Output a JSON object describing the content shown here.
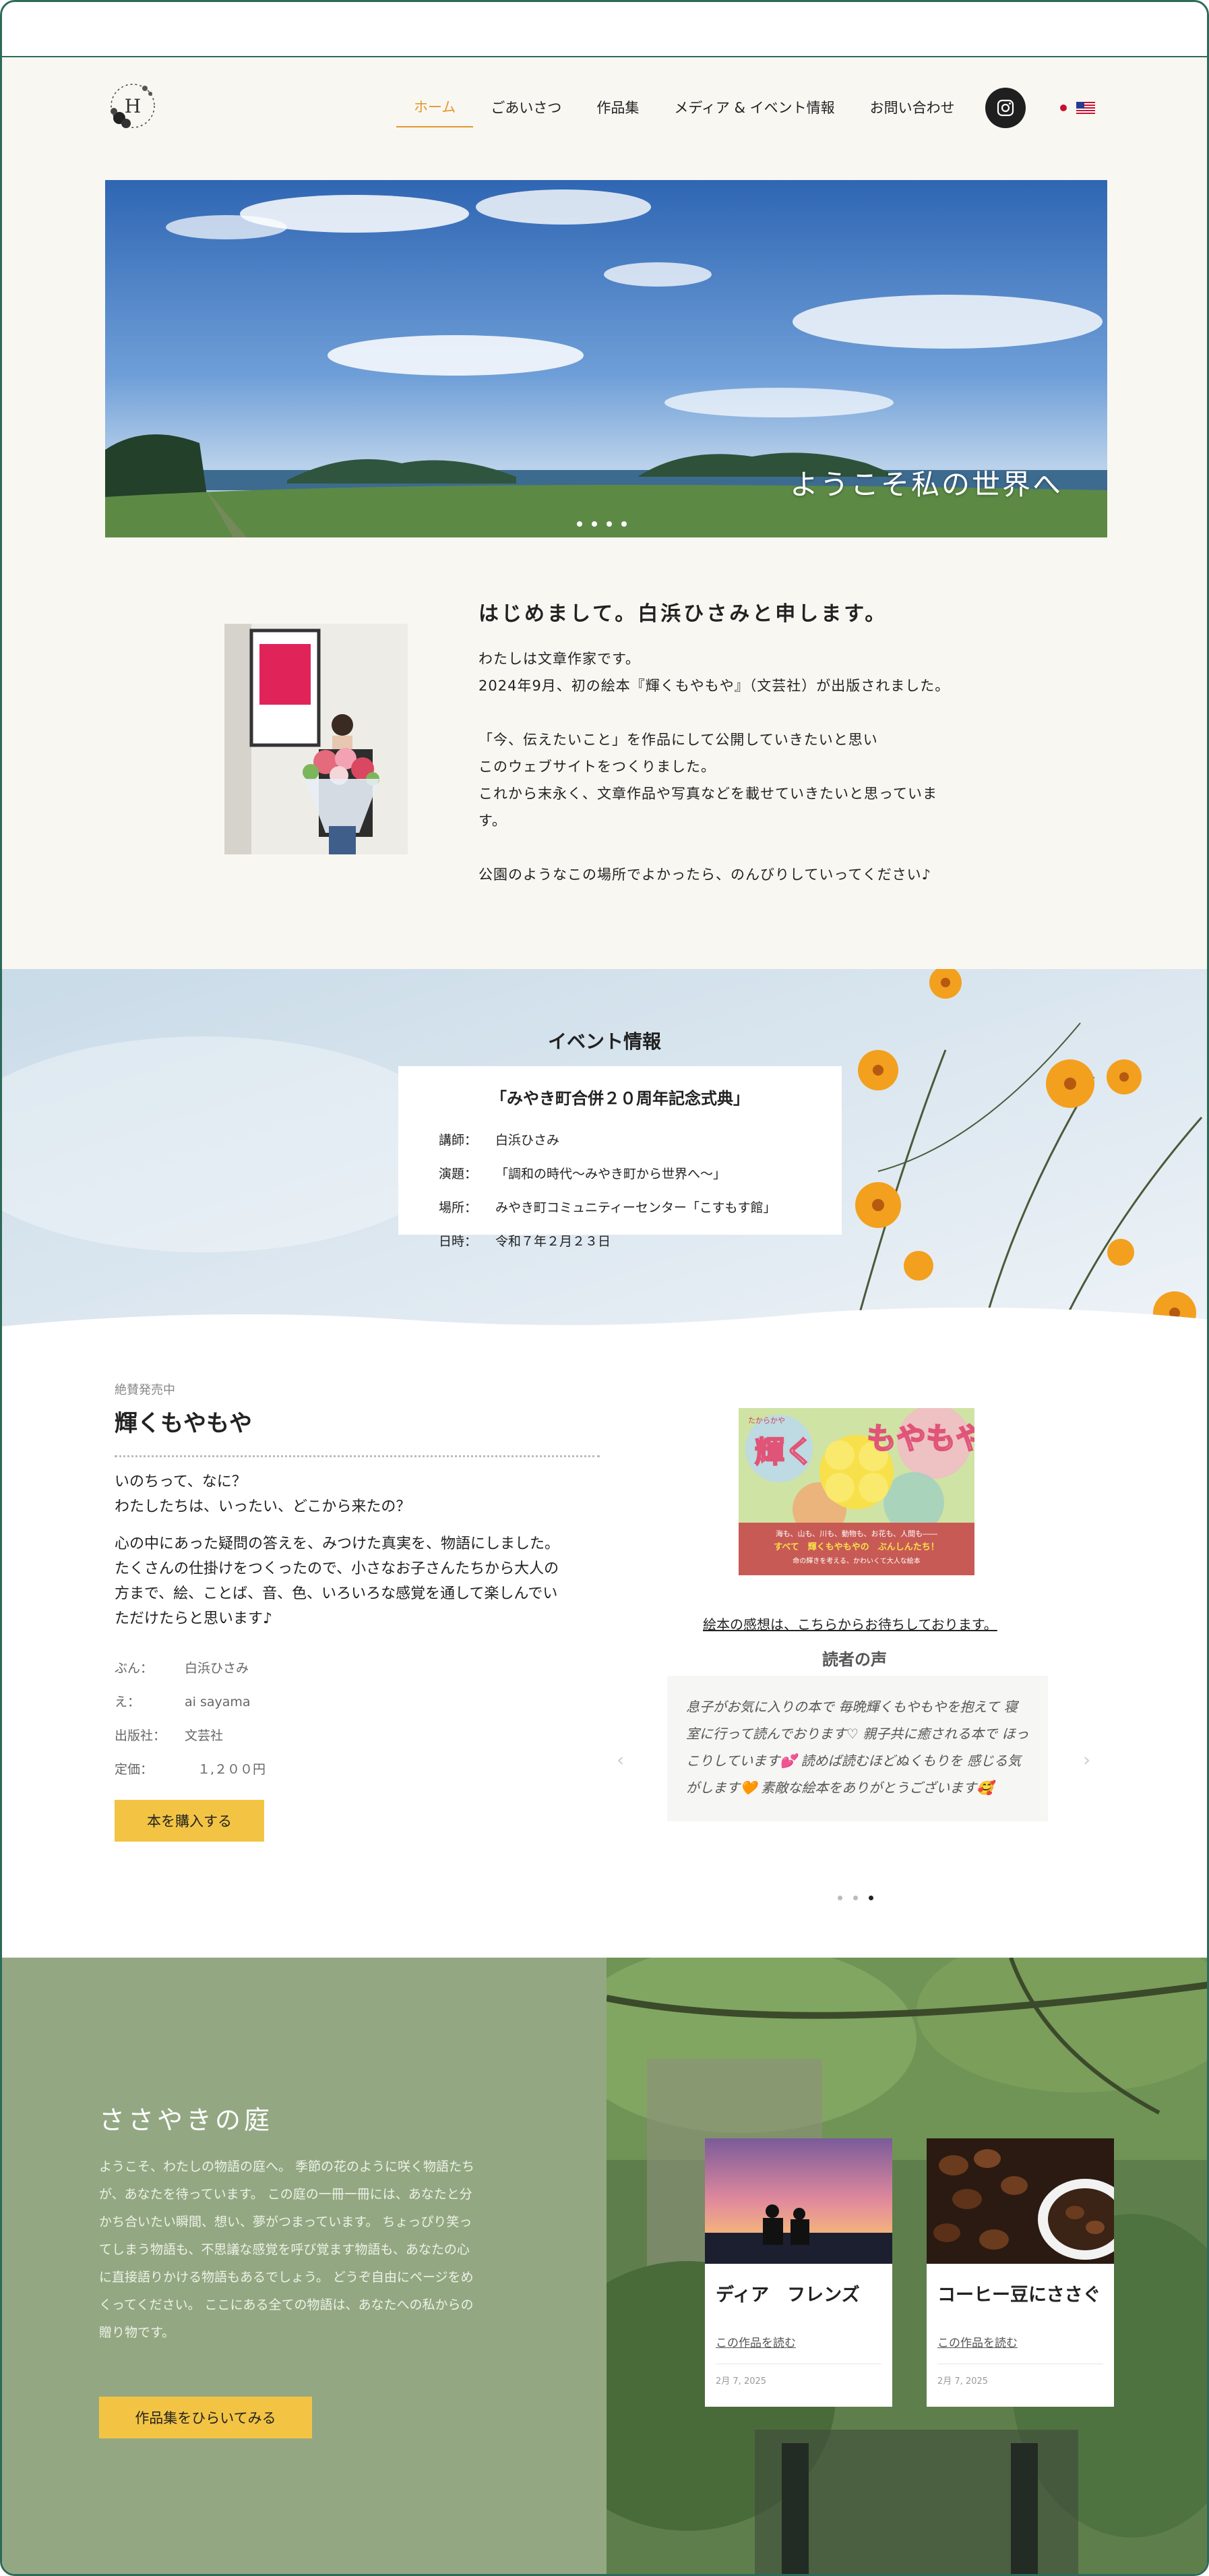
{
  "nav": {
    "logo_letter": "H",
    "items": [
      {
        "label": "ホーム",
        "active": true
      },
      {
        "label": "ごあいさつ"
      },
      {
        "label": "作品集"
      },
      {
        "label": "メディア & イベント情報"
      },
      {
        "label": "お問い合わせ"
      }
    ],
    "social_icon": "instagram-icon",
    "lang_icons": [
      "japan-flag-icon",
      "us-flag-icon"
    ]
  },
  "hero": {
    "caption": "ようこそ私の世界へ",
    "slide_count": 4
  },
  "intro": {
    "heading": "はじめまして。白浜ひさみと申します。",
    "lines1": [
      "わたしは文章作家です。",
      "2024年9月、初の絵本『輝くもやもや』（文芸社）が出版されました。"
    ],
    "lines2": [
      "「今、伝えたいこと」を作品にして公開していきたいと思い",
      "このウェブサイトをつくりました。",
      "これから末永く、文章作品や写真などを載せていきたいと思っていま",
      "す。"
    ],
    "lines3": [
      "公園のようなこの場所でよかったら、のんびりしていってください♪"
    ]
  },
  "event": {
    "title": "イベント情報",
    "card_title": "「みやき町合併２０周年記念式典」",
    "rows": [
      {
        "k": "講師：",
        "v": "白浜ひさみ"
      },
      {
        "k": "演題：",
        "v": "「調和の時代〜みやき町から世界へ〜」"
      },
      {
        "k": "場所：",
        "v": "みやき町コミュニティーセンター「こすもす館」"
      },
      {
        "k": "日時：",
        "v": "令和７年２月２３日"
      }
    ]
  },
  "book": {
    "label": "絶賛発売中",
    "title": "輝くもやもや",
    "intro": [
      "いのちって、なに？",
      "わたしたちは、いったい、どこから来たの？"
    ],
    "desc": [
      "心の中にあった疑問の答えを、みつけた真実を、物語にしました。",
      "たくさんの仕掛けをつくったので、小さなお子さんたちから大人の",
      "方まで、絵、ことば、音、色、いろいろな感覚を通して楽しんでい",
      "ただけたらと思います♪"
    ],
    "meta": [
      {
        "k": "ぶん：",
        "v": "白浜ひさみ"
      },
      {
        "k": "え：",
        "v": "ai sayama"
      },
      {
        "k": "出版社：",
        "v": "文芸社"
      },
      {
        "k": "定価：",
        "v": "　１,２００円"
      }
    ],
    "buy_label": "本を購入する",
    "cover": {
      "small": "たからかや",
      "title_a": "輝く",
      "title_b": "もやもや",
      "line1": "海も、山も、川も、動物も、お花も、人間も――",
      "line2": "すべて　輝くもやもやの　ぶんしんたち！",
      "line3": "命の輝きを考える、かわいくて大人な絵本"
    }
  },
  "reviews": {
    "link": "絵本の感想は、こちらからお待ちしております。",
    "title": "読者の声",
    "text": "息子がお気に入りの本で 毎晩輝くもやもやを抱えて 寝室に行って読んでおります♡ 親子共に癒される本で ほっこりしています💕 読めば読むほどぬくもりを 感じる気がします🧡 素敵な絵本をありがとうございます🥰",
    "dots": 3,
    "active_dot": 2
  },
  "garden": {
    "title": "ささやきの庭",
    "text": "ようこそ、わたしの物語の庭へ。 季節の花のように咲く物語たちが、あなたを待っています。 この庭の一冊一冊には、あなたと分かち合いたい瞬間、想い、夢がつまっています。 ちょっぴり笑ってしまう物語も、不思議な感覚を呼び覚ます物語も、あなたの心に直接語りかける物語もあるでしょう。 どうぞ自由にページをめくってください。 ここにある全ての物語は、あなたへの私からの贈り物です。",
    "button": "作品集をひらいてみる",
    "cards": [
      {
        "title": "ディア　フレンズ",
        "read": "この作品を読む",
        "date": "2月 7, 2025"
      },
      {
        "title": "コーヒー豆にささぐ",
        "read": "この作品を読む",
        "date": "2月 7, 2025"
      }
    ]
  }
}
